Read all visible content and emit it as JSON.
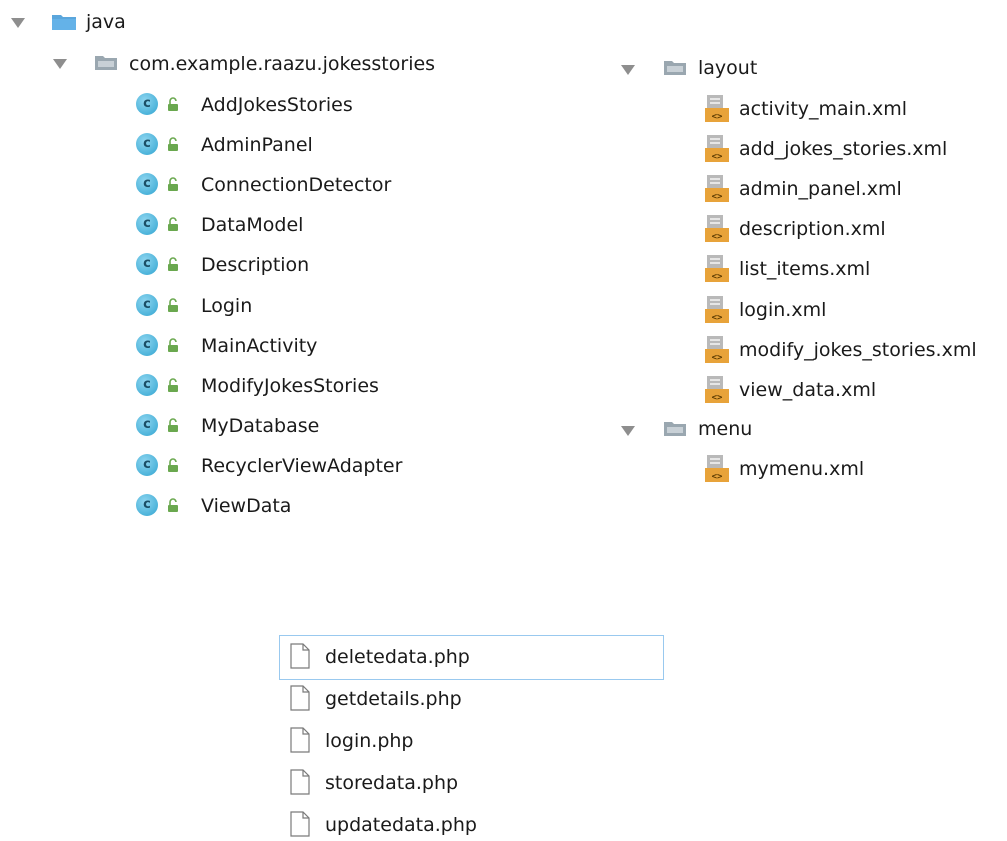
{
  "java_tree": {
    "root_label": "java",
    "package_label": "com.example.raazu.jokesstories",
    "classes": [
      "AddJokesStories",
      "AdminPanel",
      "ConnectionDetector",
      "DataModel",
      "Description",
      "Login",
      "MainActivity",
      "ModifyJokesStories",
      "MyDatabase",
      "RecyclerViewAdapter",
      "ViewData"
    ],
    "class_icon_letter": "c"
  },
  "res_tree": {
    "layout_label": "layout",
    "layout_files": [
      "activity_main.xml",
      "add_jokes_stories.xml",
      "admin_panel.xml",
      "description.xml",
      "list_items.xml",
      "login.xml",
      "modify_jokes_stories.xml",
      "view_data.xml"
    ],
    "menu_label": "menu",
    "menu_files": [
      "mymenu.xml"
    ]
  },
  "php_files": {
    "items": [
      "deletedata.php",
      "getdetails.php",
      "login.php",
      "storedata.php",
      "updatedata.php"
    ],
    "selected_index": 0
  },
  "colors": {
    "folder_blue": "#5aa6dc",
    "folder_grey": "#9aa7b0",
    "class_icon": "#4cb3da",
    "lock_green": "#6aa84f",
    "xml_orange": "#e8a33a",
    "arrow_grey": "#8e8e8e",
    "selection_border": "#99c9ef"
  }
}
